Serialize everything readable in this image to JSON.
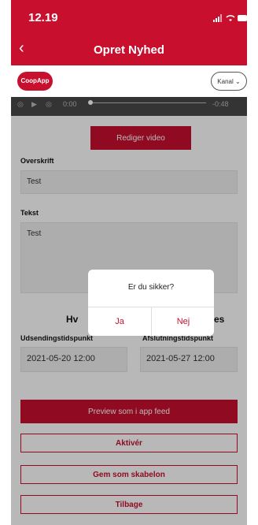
{
  "status_bar": {
    "time": "12.19"
  },
  "nav": {
    "back_icon": "chevron-left",
    "title": "Opret Nyhed"
  },
  "channel_bar": {
    "app_chip": "CoopApp",
    "channel_label": "Kanal"
  },
  "video": {
    "elapsed": "0:00",
    "remaining": "-0:48"
  },
  "actions": {
    "edit_video": "Rediger video"
  },
  "form": {
    "headline_label": "Overskrift",
    "headline_value": "Test",
    "text_label": "Tekst",
    "text_value": "Test",
    "section_heading_left": "Hv",
    "section_heading_right": "es",
    "send_time_label": "Udsendingstidspunkt",
    "send_time_value": "2021-05-20 12:00",
    "end_time_label": "Afslutningstidspunkt",
    "end_time_value": "2021-05-27 12:00"
  },
  "buttons": {
    "preview": "Preview som i app feed",
    "activate": "Aktivér",
    "save_template": "Gem som skabelon",
    "back": "Tilbage"
  },
  "dialog": {
    "title": "Er du sikker?",
    "yes": "Ja",
    "no": "Nej"
  },
  "colors": {
    "accent": "#c8102e"
  }
}
